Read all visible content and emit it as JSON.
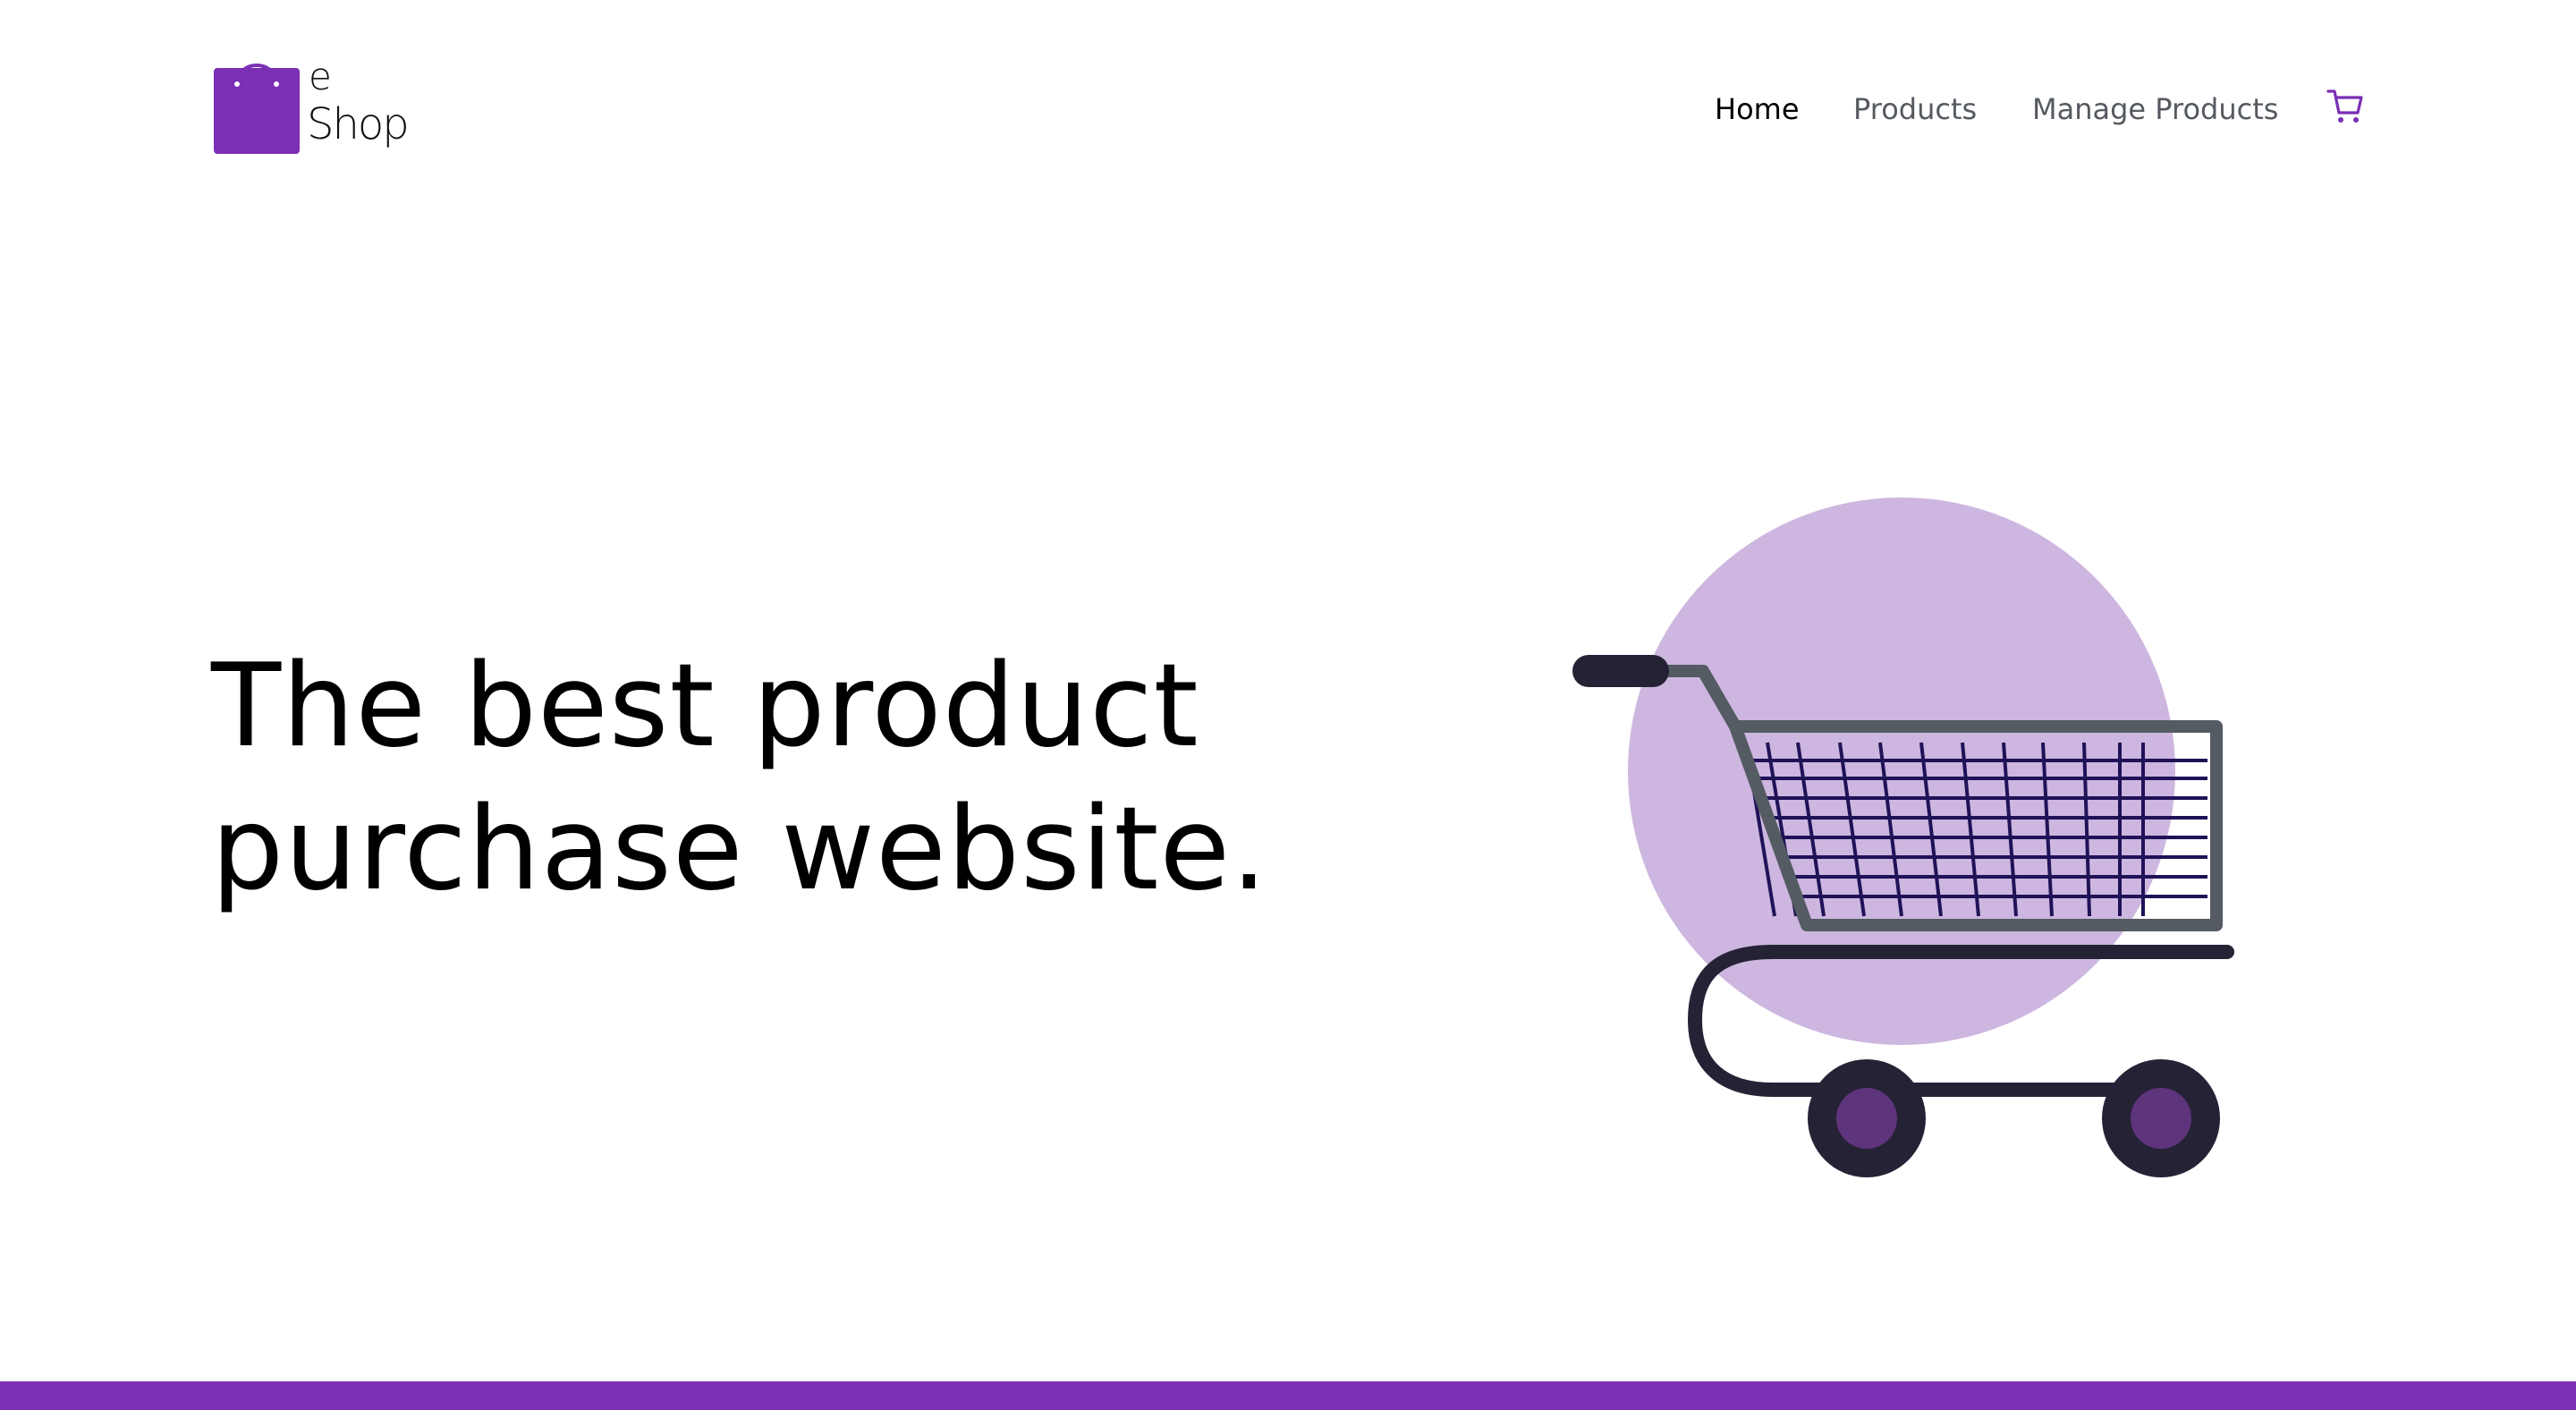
{
  "brand": {
    "logo_e": "e",
    "logo_shop": "Shop",
    "color": "#7b2fb5"
  },
  "nav": {
    "items": [
      {
        "label": "Home",
        "active": true
      },
      {
        "label": "Products",
        "active": false
      },
      {
        "label": "Manage Products",
        "active": false
      }
    ],
    "cart_icon": "cart-icon"
  },
  "hero": {
    "line1": "The best product",
    "line2": "purchase website.",
    "illustration": "shopping-cart-illustration"
  },
  "colors": {
    "accent": "#7b2fb5",
    "circle": "#cdb6df",
    "cart_frame": "#545b63",
    "cart_handle": "#262236",
    "wheel_hub": "#5e347c",
    "text_nav": "#555a60",
    "text_dark": "#000000"
  }
}
